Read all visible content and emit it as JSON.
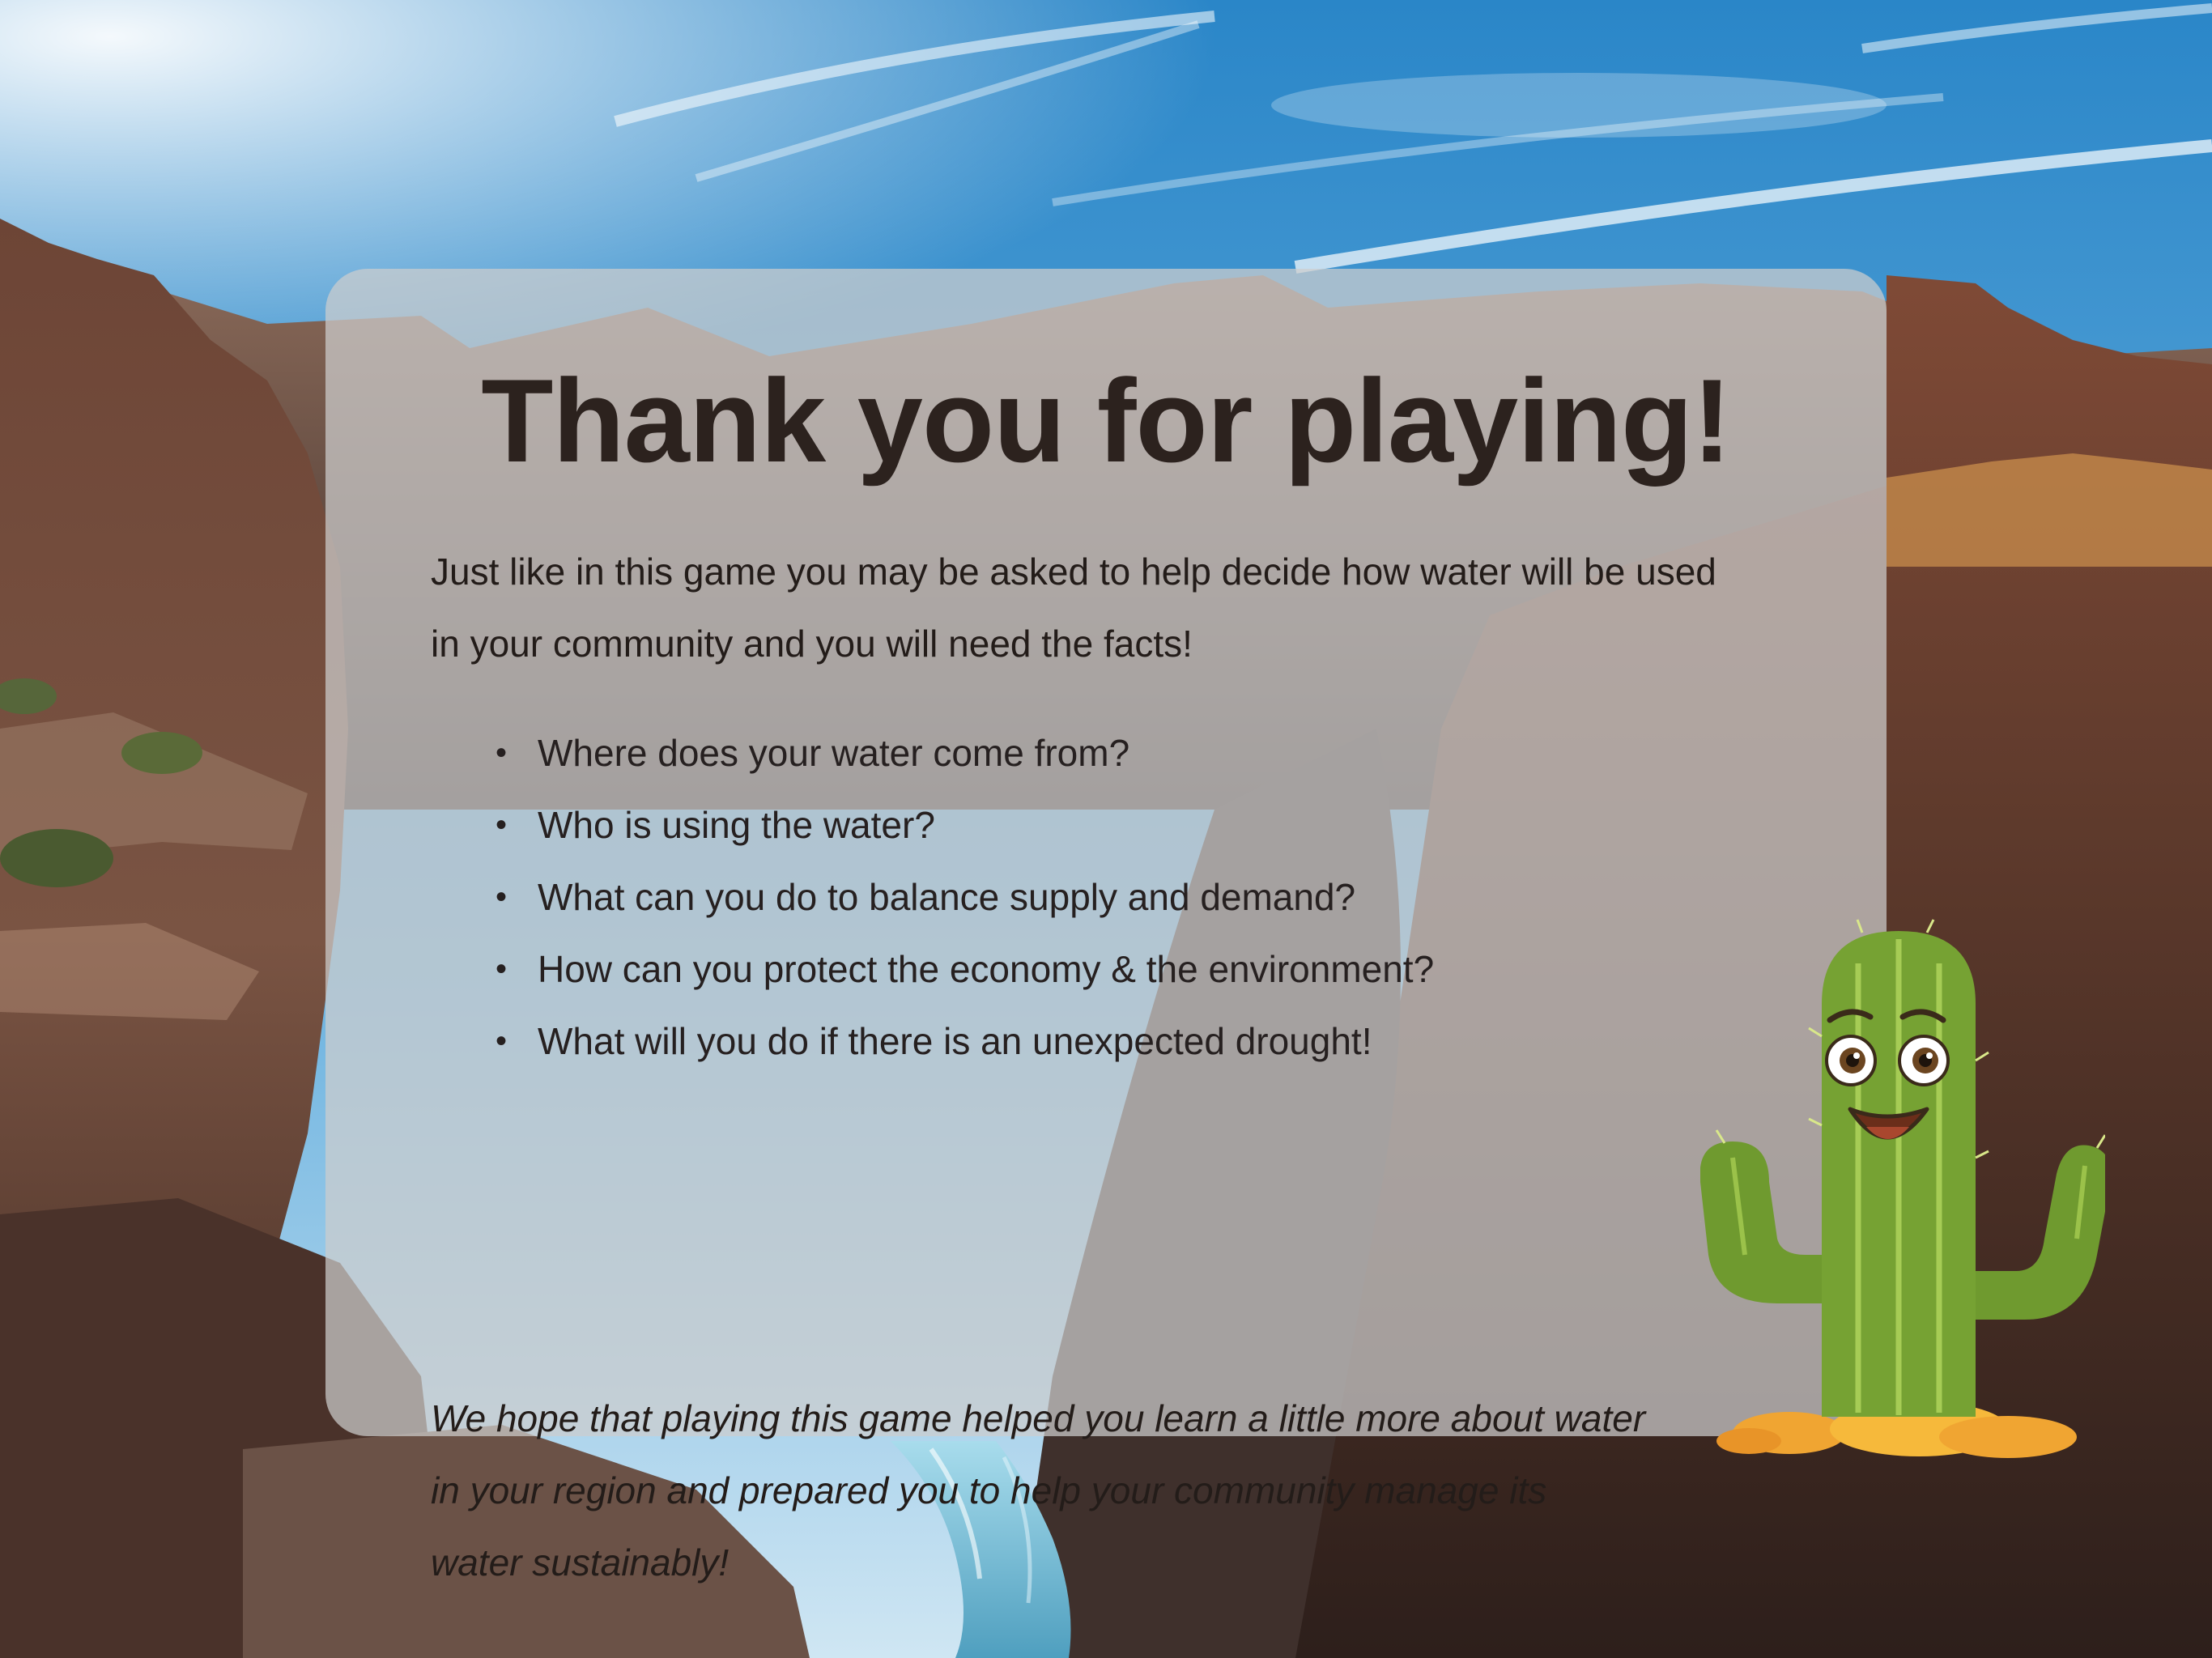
{
  "title": "Thank you for playing!",
  "intro": {
    "line1": "Just like in this game you may be asked to help decide how water will be used",
    "line2": "in your community and you will need the facts!"
  },
  "questions": [
    "Where does your water come from?",
    "Who is using the water?",
    "What can you do to balance supply and demand?",
    "How can you protect the economy & the environment?",
    "What will you do if there is an unexpected drought!"
  ],
  "bullet_glyph": "•",
  "closing": {
    "line1": "We hope that playing this game helped you learn a little more about water",
    "line2": "in your region and prepared you to help your community manage its",
    "line3": "water sustainably!"
  },
  "colors": {
    "panel": "#cdcdcd",
    "title_text": "#2c221e",
    "cactus_green": "#6f9a2f",
    "sky": "#2f8fcf",
    "canyon_rock": "#6b4a3a",
    "river": "#7fc6e0"
  },
  "icons": {
    "mascot": "cactus-mascot-icon",
    "background": "canyon-landscape"
  }
}
